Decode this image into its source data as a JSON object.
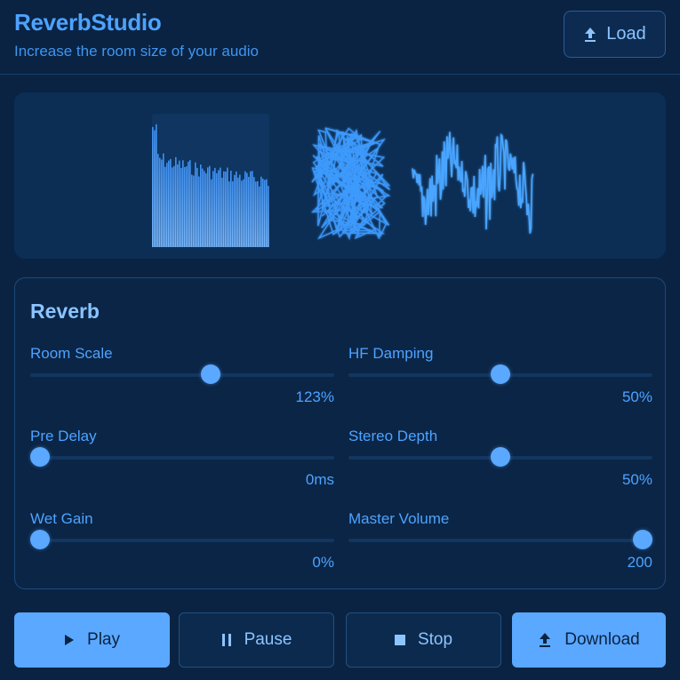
{
  "app": {
    "title": "ReverbStudio",
    "subtitle": "Increase the room size of your audio"
  },
  "header": {
    "load_label": "Load",
    "load_icon": "upload-icon"
  },
  "visualizer": {
    "panels": [
      "decay-bars",
      "vectorscope",
      "waveform"
    ]
  },
  "reverb": {
    "title": "Reverb",
    "controls": [
      {
        "key": "room_scale",
        "label": "Room Scale",
        "value_text": "123%",
        "position": 0.6
      },
      {
        "key": "hf_damping",
        "label": "HF Damping",
        "value_text": "50%",
        "position": 0.5
      },
      {
        "key": "pre_delay",
        "label": "Pre Delay",
        "value_text": "0ms",
        "position": 0.0
      },
      {
        "key": "stereo_depth",
        "label": "Stereo Depth",
        "value_text": "50%",
        "position": 0.5
      },
      {
        "key": "wet_gain",
        "label": "Wet Gain",
        "value_text": "0%",
        "position": 0.0
      },
      {
        "key": "master_volume",
        "label": "Master Volume",
        "value_text": "200",
        "position": 1.0
      }
    ]
  },
  "transport": {
    "play_label": "Play",
    "pause_label": "Pause",
    "stop_label": "Stop",
    "download_label": "Download"
  },
  "colors": {
    "background": "#0a2342",
    "accent": "#5aa8ff",
    "panel": "#0c2e55"
  }
}
